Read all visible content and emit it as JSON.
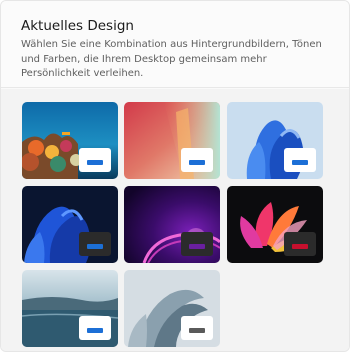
{
  "section": {
    "title": "Aktuelles Design",
    "description": "Wählen Sie eine Kombination aus Hintergrundbildern, Tönen und Farben, die Ihrem Desktop gemeinsam mehr Persönlichkeit verleihen."
  },
  "themes": [
    {
      "id": "underwater",
      "icon": "theme-preview-underwater",
      "badge_color": "#ffffff",
      "accent": "#1c6fd6"
    },
    {
      "id": "gradient",
      "icon": "theme-preview-gradient",
      "badge_color": "#ffffff",
      "accent": "#1c6fd6"
    },
    {
      "id": "bloom-light",
      "icon": "theme-preview-bloom-light",
      "badge_color": "#ffffff",
      "accent": "#1c6fd6"
    },
    {
      "id": "bloom-dark",
      "icon": "theme-preview-bloom-dark",
      "badge_color": "#2b2b2b",
      "accent": "#1c6fd6"
    },
    {
      "id": "glow",
      "icon": "theme-preview-glow",
      "badge_color": "#2b2b2b",
      "accent": "#6a1fa0"
    },
    {
      "id": "captured-motion",
      "icon": "theme-preview-captured-motion",
      "badge_color": "#2b2b2b",
      "accent": "#c8102e"
    },
    {
      "id": "lake",
      "icon": "theme-preview-lake",
      "badge_color": "#ffffff",
      "accent": "#1c6fd6"
    },
    {
      "id": "flow",
      "icon": "theme-preview-flow",
      "badge_color": "#ffffff",
      "accent": "#5a5a5a"
    }
  ]
}
